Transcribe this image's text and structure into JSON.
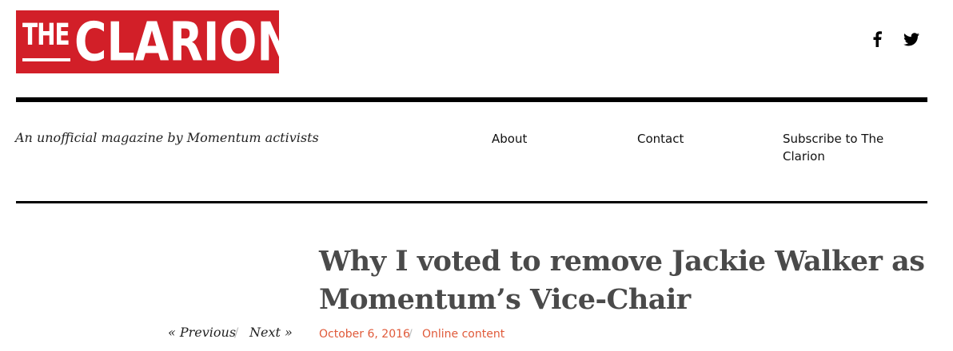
{
  "header": {
    "logo_the": "THE",
    "logo_clarion": "CLARION",
    "brand_color": "#d21f28",
    "social": [
      {
        "icon": "facebook-icon"
      },
      {
        "icon": "twitter-icon"
      }
    ]
  },
  "tagline": "An unofficial magazine by Momentum activists",
  "nav": {
    "about": "About",
    "contact": "Contact",
    "subscribe": "Subscribe to The Clarion"
  },
  "article": {
    "title": "Why I voted to remove Jackie Walker as Momentum’s Vice-Chair",
    "date": "October 6, 2016",
    "meta_separator": "/",
    "category": "Online content",
    "accent_color": "#e05a3a"
  },
  "pager": {
    "previous": "« Previous",
    "separator": "/",
    "next": "Next »"
  }
}
